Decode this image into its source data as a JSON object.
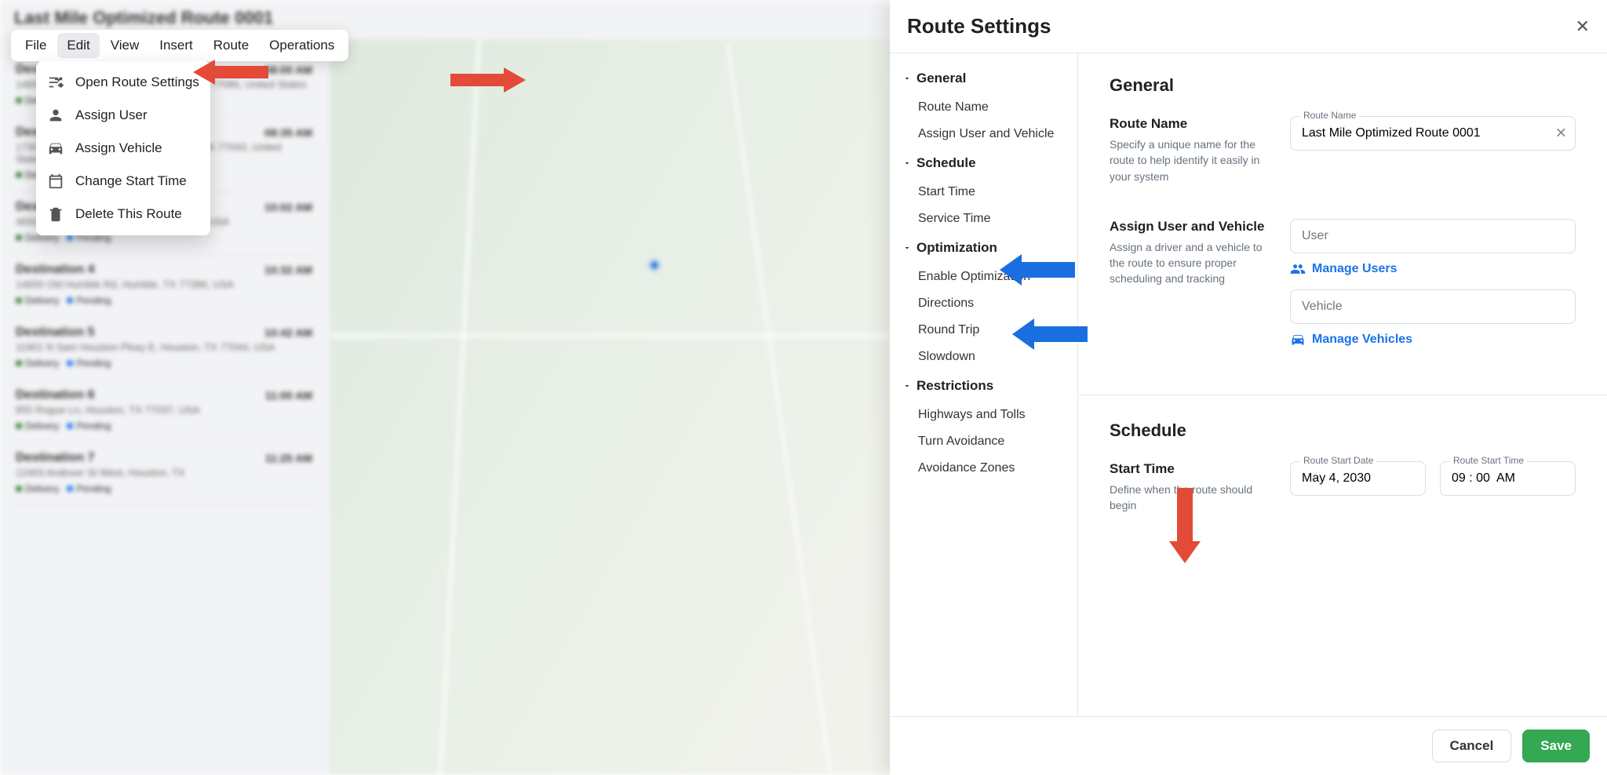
{
  "bg_title": "Last Mile Optimized Route 0001",
  "menubar": {
    "items": [
      "File",
      "Edit",
      "View",
      "Insert",
      "Route",
      "Operations"
    ],
    "active_index": 1
  },
  "dropdown": {
    "items": [
      {
        "label": "Open Route Settings",
        "icon": "sliders"
      },
      {
        "label": "Assign User",
        "icon": "user"
      },
      {
        "label": "Assign Vehicle",
        "icon": "car"
      },
      {
        "label": "Change Start Time",
        "icon": "calendar"
      },
      {
        "label": "Delete This Route",
        "icon": "trash"
      }
    ]
  },
  "bg_stops": [
    {
      "title": "Destination 1",
      "addr": "14650 Sam Houston Pkwy N, Houston, TX 77086, United States",
      "time": "08:00 AM"
    },
    {
      "title": "Destination 2",
      "addr": "1730 W Sam Houston Pkwy N, Houston, TX 77043, United States",
      "time": "08:35 AM"
    },
    {
      "title": "Destination 3",
      "addr": "4650 Homestead Rd, Houston, TX 77016, USA",
      "time": "10:02 AM"
    },
    {
      "title": "Destination 4",
      "addr": "14650 Old Humble Rd, Humble, TX 77396, USA",
      "time": "10:32 AM"
    },
    {
      "title": "Destination 5",
      "addr": "11901 N Sam Houston Pkwy E, Houston, TX 77044, USA",
      "time": "10:42 AM"
    },
    {
      "title": "Destination 6",
      "addr": "855 Rogue Ln, Houston, TX 77037, USA",
      "time": "11:00 AM"
    },
    {
      "title": "Destination 7",
      "addr": "12403 Andover St West, Houston, TX",
      "time": "11:25 AM"
    }
  ],
  "bg_tag_delivery": "Delivery",
  "bg_tag_pending": "Pending",
  "modal": {
    "title": "Route Settings",
    "nav": {
      "general": {
        "header": "General",
        "items": [
          "Route Name",
          "Assign User and Vehicle"
        ]
      },
      "schedule": {
        "header": "Schedule",
        "items": [
          "Start Time",
          "Service Time"
        ]
      },
      "optimization": {
        "header": "Optimization",
        "items": [
          "Enable Optimization",
          "Directions",
          "Round Trip",
          "Slowdown"
        ]
      },
      "restrictions": {
        "header": "Restrictions",
        "items": [
          "Highways and Tolls",
          "Turn Avoidance",
          "Avoidance Zones"
        ]
      }
    },
    "general_heading": "General",
    "route_name": {
      "title": "Route Name",
      "desc": "Specify a unique name for the route to help identify it easily in your system",
      "label": "Route Name",
      "value": "Last Mile Optimized Route 0001"
    },
    "assign": {
      "title": "Assign User and Vehicle",
      "desc": "Assign a driver and a vehicle to the route to ensure proper scheduling and tracking",
      "user_placeholder": "User",
      "vehicle_placeholder": "Vehicle",
      "manage_users": "Manage Users",
      "manage_vehicles": "Manage Vehicles"
    },
    "schedule_heading": "Schedule",
    "start_time": {
      "title": "Start Time",
      "desc": "Define when the route should begin",
      "date_label": "Route Start Date",
      "date_value": "May 4, 2030",
      "time_label": "Route Start Time",
      "time_value": "09 : 00  AM"
    },
    "footer": {
      "cancel": "Cancel",
      "save": "Save"
    }
  }
}
